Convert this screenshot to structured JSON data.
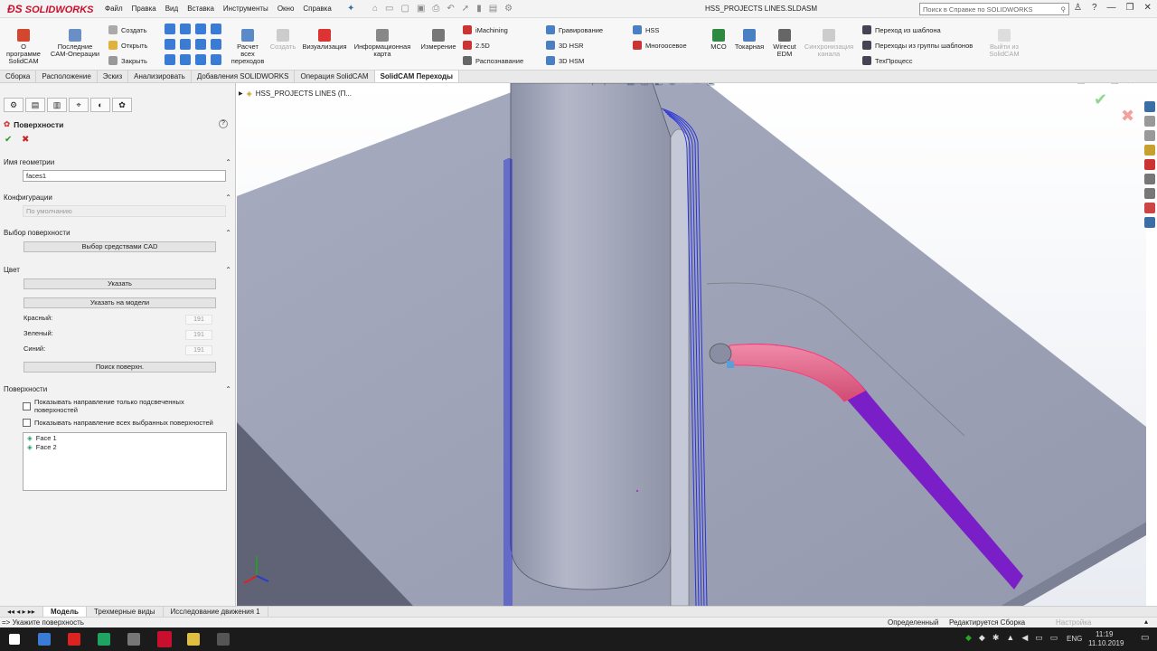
{
  "app": {
    "logo": "SOLIDWORKS",
    "doc_title": "HSS_PROJECTS LINES.SLDASM"
  },
  "menu": [
    "Файл",
    "Правка",
    "Вид",
    "Вставка",
    "Инструменты",
    "Окно",
    "Справка"
  ],
  "help_search": {
    "placeholder": "Поиск в Справке по SOLIDWORKS"
  },
  "ribbon": {
    "about": "О программе SolidCAM",
    "recent": "Последние CAM-Операции",
    "create": "Создать",
    "open": "Открыть",
    "close": "Закрыть",
    "calc_all": "Расчет всех переходов",
    "create2": "Создать",
    "visualize": "Визуализация",
    "infomap": "Информационная карта",
    "measure": "Измерение",
    "imachining": "iMachining",
    "d25": "2.5D",
    "recognition": "Распознавание",
    "engraving": "Гравирование",
    "hsr": "3D HSR",
    "hsm": "3D HSM",
    "hss": "HSS",
    "multiaxis": "Многоосевое",
    "mco": "MCO",
    "turning": "Токарная",
    "wirecut": "Wirecut EDM",
    "sync": "Синхронизация канала",
    "tpl_transition": "Переход из шаблона",
    "tpl_group": "Переходы из группы шаблонов",
    "techprocess": "ТехПроцесс",
    "exit": "Выйти из SolidCAM"
  },
  "tabs": [
    "Сборка",
    "Расположение",
    "Эскиз",
    "Анализировать",
    "Добавления SOLIDWORKS",
    "Операция SolidCAM",
    "SolidCAM Переходы"
  ],
  "tree_root": "HSS_PROJECTS LINES  (П...",
  "panel": {
    "title": "Поверхности",
    "help": "?",
    "ok": "✔",
    "cancel": "✖",
    "geom_header": "Имя геометрии",
    "geom_value": "faces1",
    "config_header": "Конфигурации",
    "config_value": "По умолчанию",
    "select_header": "Выбор поверхности",
    "cad_button": "Выбор средствами CAD",
    "color_header": "Цвет",
    "specify_button": "Указать",
    "specify_model_button": "Указать на модели",
    "red_label": "Красный:",
    "green_label": "Зеленый:",
    "blue_label": "Синий:",
    "red": "191",
    "green": "191",
    "blue": "191",
    "find_button": "Поиск поверхн.",
    "faces_header": "Поверхности",
    "chk1": "Показывать направление только подсвеченных поверхностей",
    "chk2": "Показывать направление всех выбранных поверхностей",
    "faces": [
      "Face 1",
      "Face 2"
    ]
  },
  "bottom_tabs": [
    "Модель",
    "Трехмерные виды",
    "Исследование движения 1"
  ],
  "status": {
    "prompt": "=> Укажите поверхность",
    "defined": "Определенный",
    "editing": "Редактируется Сборка",
    "settings": "Настройка"
  },
  "taskbar": {
    "lang": "ENG",
    "time": "11:19",
    "date": "11.10.2019"
  },
  "colors": {
    "accent": "#c8102e",
    "model": "#9fa4b8",
    "highlight": "#e0507a",
    "path": "#7a1ec8",
    "wire": "#2b35d6"
  }
}
